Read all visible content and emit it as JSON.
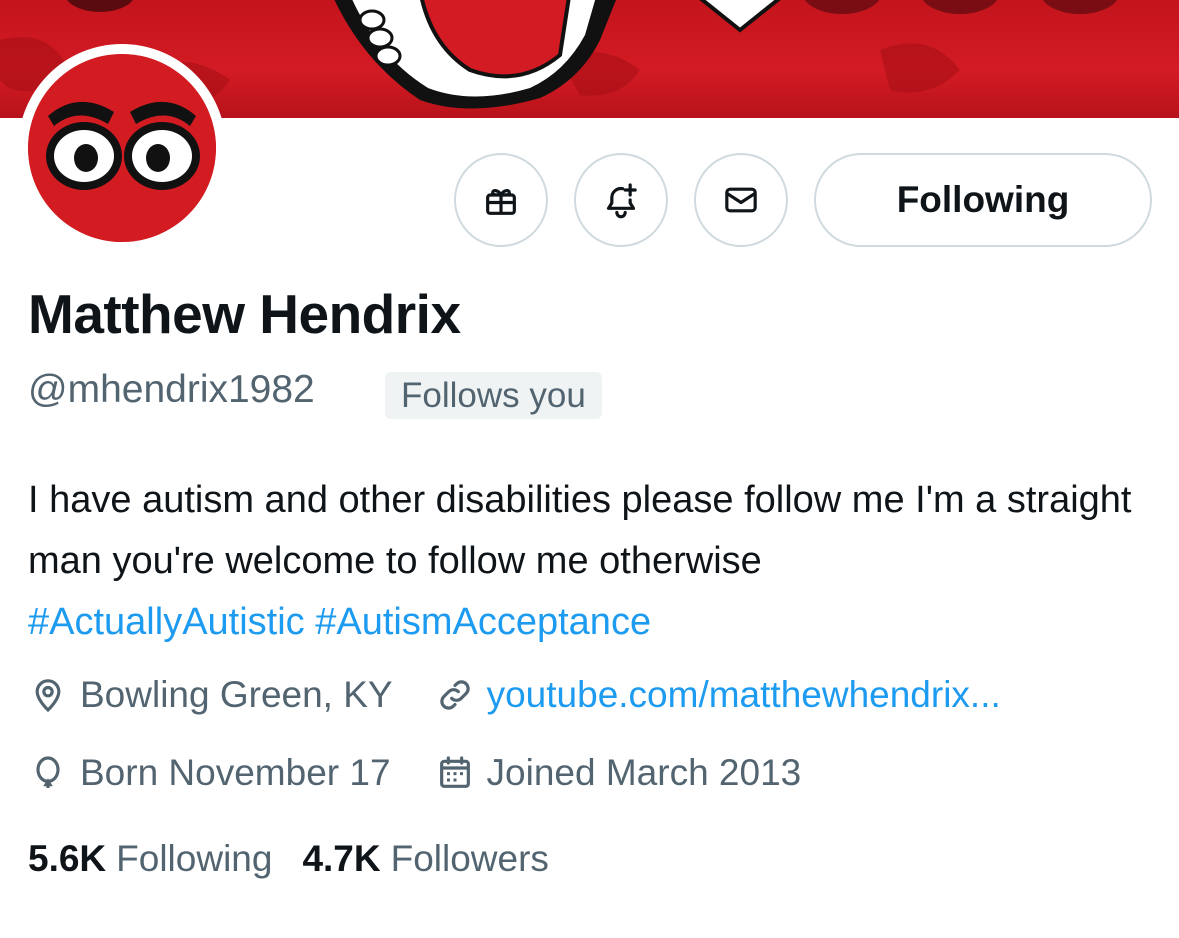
{
  "profile": {
    "name": "Matthew Hendrix",
    "handle": "@mhendrix1982",
    "follows_you": "Follows you",
    "bio_text": "I have autism and other disabilities please follow me I'm a straight man you're welcome to follow me otherwise",
    "hashtags": [
      "#ActuallyAutistic",
      "#AutismAcceptance"
    ],
    "location": "Bowling Green, KY",
    "website": "youtube.com/matthewhendrix...",
    "birthday": "Born November 17",
    "joined": "Joined March 2013",
    "following_count": "5.6K",
    "following_label": "Following",
    "followers_count": "4.7K",
    "followers_label": "Followers"
  },
  "actions": {
    "gift_icon": "gift-icon",
    "notify_icon": "bell-plus-icon",
    "message_icon": "mail-icon",
    "follow_button_label": "Following"
  },
  "colors": {
    "banner_red": "#d31b24",
    "link_blue": "#1d9bf0",
    "secondary_text": "#536471",
    "border": "#cfd9de"
  }
}
